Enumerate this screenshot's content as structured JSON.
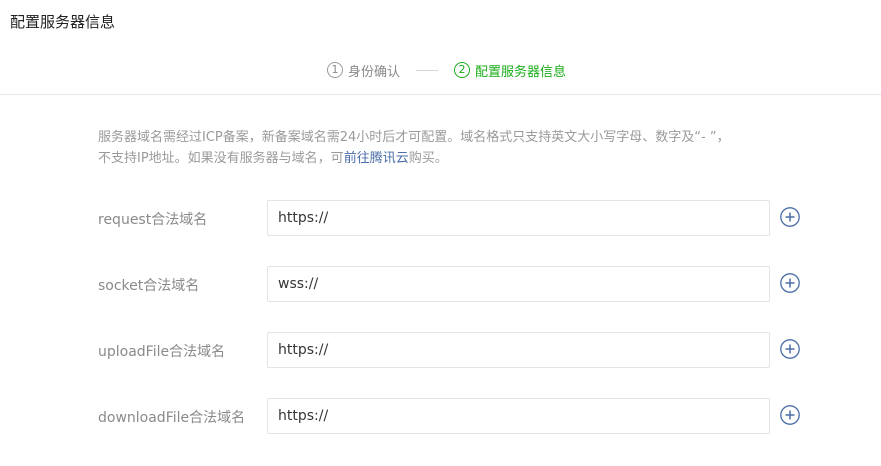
{
  "page": {
    "title": "配置服务器信息"
  },
  "steps": [
    {
      "num": "1",
      "label": "身份确认",
      "active": false
    },
    {
      "num": "2",
      "label": "配置服务器信息",
      "active": true
    }
  ],
  "notice": {
    "line1": "服务器域名需经过ICP备案，新备案域名需24小时后才可配置。域名格式只支持英文大小写字母、数字及“- ”，",
    "line2_prefix": "不支持IP地址。如果没有服务器与域名，可",
    "link": "前往腾讯云",
    "line2_suffix": "购买。"
  },
  "fields": [
    {
      "label": "request合法域名",
      "value": "https://"
    },
    {
      "label": "socket合法域名",
      "value": "wss://"
    },
    {
      "label": "uploadFile合法域名",
      "value": "https://"
    },
    {
      "label": "downloadFile合法域名",
      "value": "https://"
    }
  ],
  "colors": {
    "accent": "#1aad19",
    "link": "#4a6ea8",
    "add_icon": "#4a6ea8"
  },
  "icons": {
    "add": "plus-circle-icon"
  }
}
